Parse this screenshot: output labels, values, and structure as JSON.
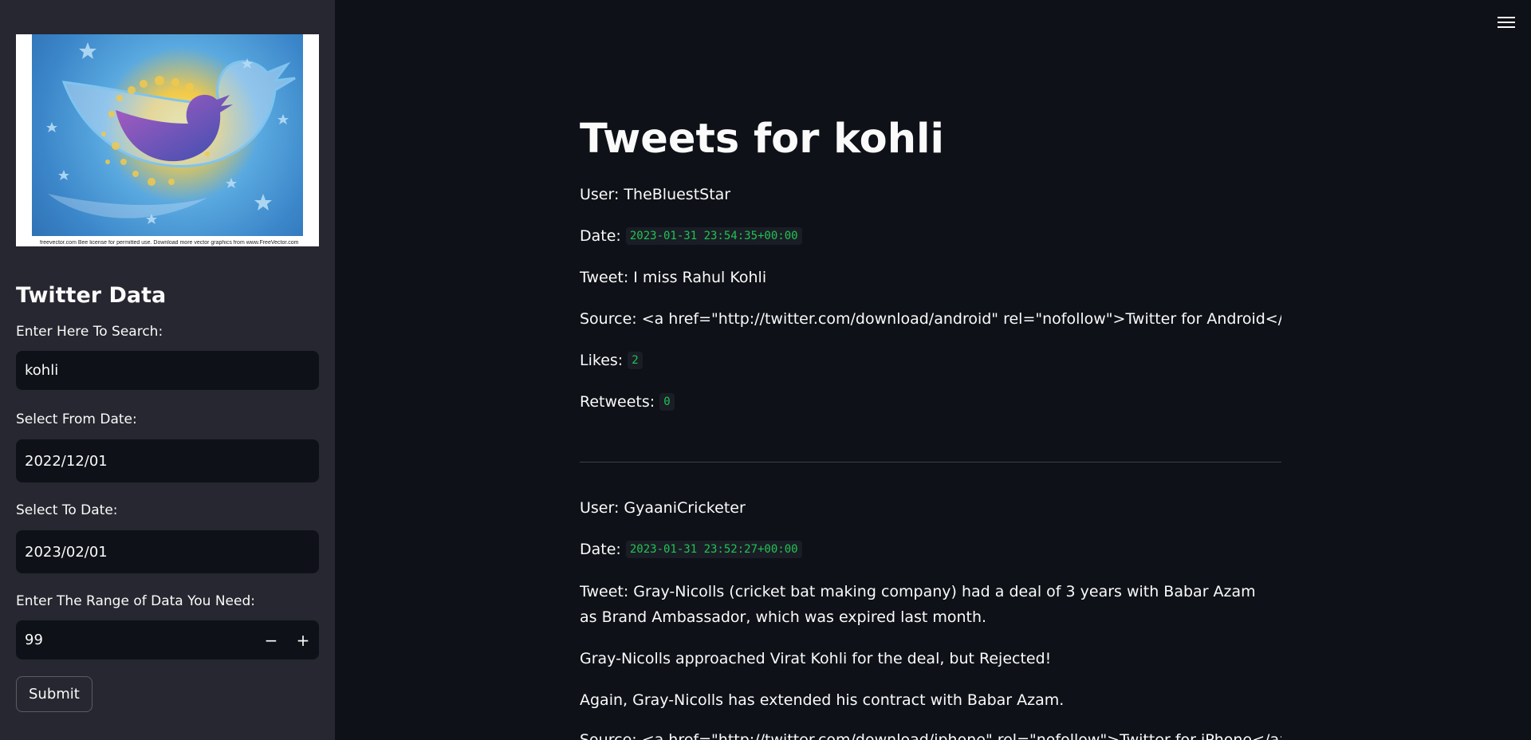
{
  "sidebar": {
    "logo_footer": "freevector.com   Bee license for permitted use. Download more vector graphics from www.FreeVector.com",
    "title": "Twitter Data",
    "search_label": "Enter Here To Search:",
    "search_value": "kohli",
    "from_label": "Select From Date:",
    "from_value": "2022/12/01",
    "to_label": "Select To Date:",
    "to_value": "2023/02/01",
    "range_label": "Enter The Range of Data You Need:",
    "range_value": "99",
    "minus": "−",
    "plus": "+",
    "submit_label": "Submit"
  },
  "main": {
    "title": "Tweets for kohli",
    "tweets": [
      {
        "user_prefix": "User: ",
        "user": "TheBluestStar",
        "date_prefix": "Date: ",
        "date": "2023-01-31 23:54:35+00:00",
        "tweet_prefix": "Tweet: ",
        "tweet": "I miss Rahul Kohli",
        "source_prefix": "Source: ",
        "source": "<a href=\"http://twitter.com/download/android\" rel=\"nofollow\">Twitter for Android</a>",
        "likes_prefix": "Likes: ",
        "likes": "2",
        "retweets_prefix": "Retweets: ",
        "retweets": "0"
      },
      {
        "user_prefix": "User: ",
        "user": "GyaaniCricketer",
        "date_prefix": "Date: ",
        "date": "2023-01-31 23:52:27+00:00",
        "tweet_prefix": "Tweet: ",
        "tweet": "Gray-Nicolls (cricket bat making company) had a deal of 3 years with Babar Azam as Brand Ambassador, which was expired last month.",
        "tweet_p2": "Gray-Nicolls approached Virat Kohli for the deal, but Rejected!",
        "tweet_p3": "Again, Gray-Nicolls has extended his contract with Babar Azam.",
        "source_prefix": "Source: ",
        "source": "<a href=\"http://twitter.com/download/iphone\" rel=\"nofollow\">Twitter for iPhone</a>"
      }
    ]
  }
}
